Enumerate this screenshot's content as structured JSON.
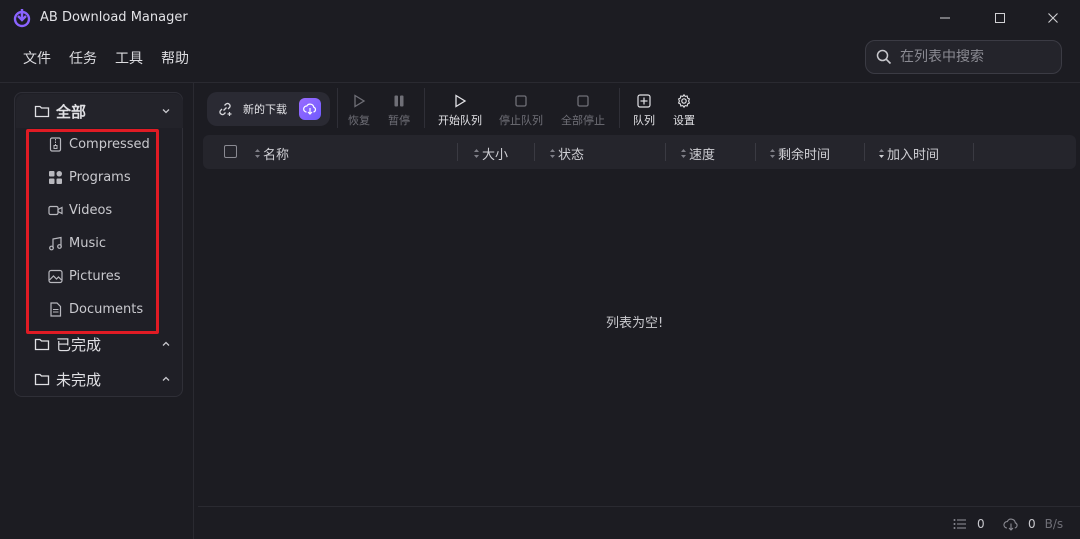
{
  "window": {
    "title": "AB Download Manager"
  },
  "menu": {
    "items": [
      "文件",
      "任务",
      "工具",
      "帮助"
    ]
  },
  "search": {
    "placeholder": "在列表中搜索"
  },
  "sidebar": {
    "all_label": "全部",
    "sub_items": [
      {
        "label": "Compressed",
        "icon": "zip-file-icon"
      },
      {
        "label": "Programs",
        "icon": "apps-grid-icon"
      },
      {
        "label": "Videos",
        "icon": "video-camera-icon"
      },
      {
        "label": "Music",
        "icon": "music-note-icon"
      },
      {
        "label": "Pictures",
        "icon": "image-icon"
      },
      {
        "label": "Documents",
        "icon": "document-icon"
      }
    ],
    "completed_label": "已完成",
    "incomplete_label": "未完成",
    "highlight_color": "#e01b24"
  },
  "toolbar": {
    "new_download": "新的下载",
    "resume": "恢复",
    "pause": "暂停",
    "start_queue": "开始队列",
    "stop_queue": "停止队列",
    "stop_all": "全部停止",
    "queues": "队列",
    "settings": "设置"
  },
  "table": {
    "columns": [
      "名称",
      "大小",
      "状态",
      "速度",
      "剩余时间",
      "加入时间"
    ],
    "empty_text": "列表为空!"
  },
  "footer": {
    "active_count": "0",
    "speed_value": "0",
    "speed_unit": "B/s"
  },
  "colors": {
    "accent": "#8a63ff",
    "background": "#1c1c22"
  }
}
